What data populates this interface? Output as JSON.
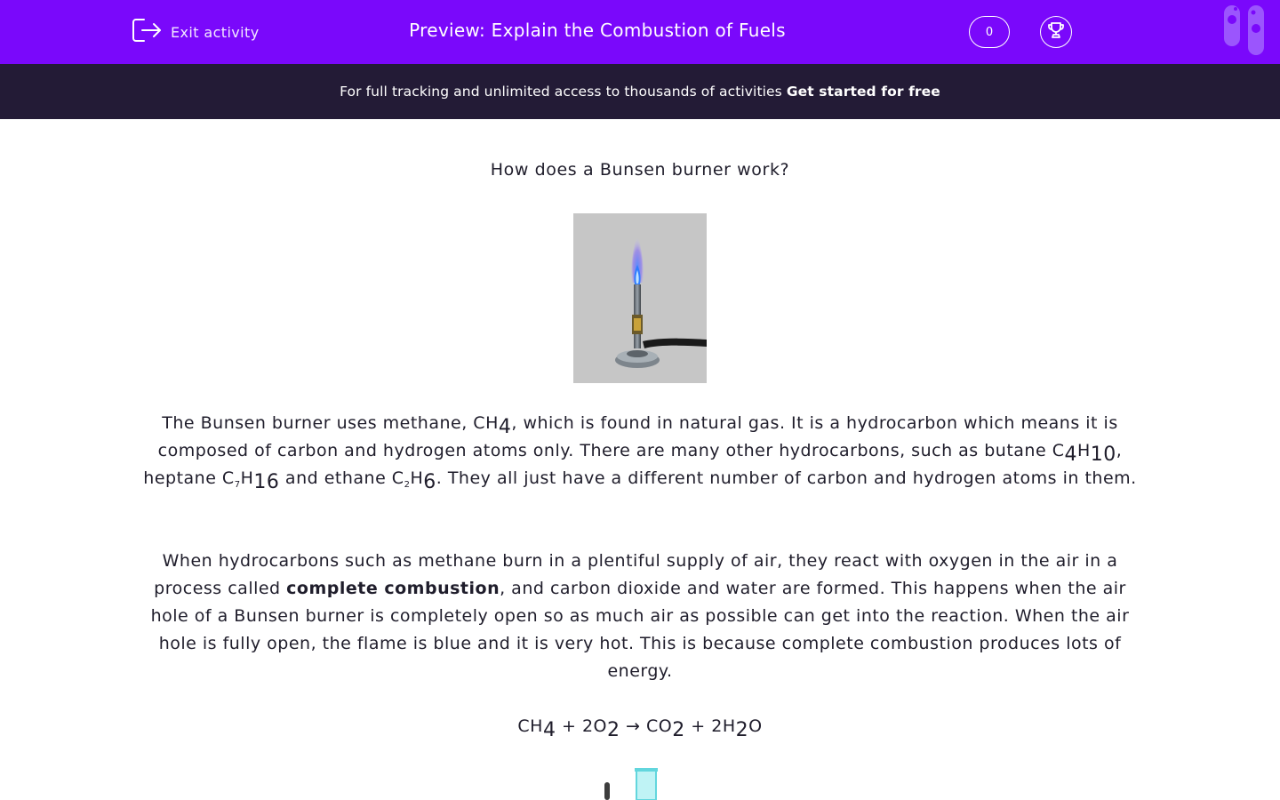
{
  "header": {
    "exit_label": "Exit activity",
    "title": "Preview: Explain the Combustion of Fuels",
    "score": "0",
    "accent_color": "#7a08fb"
  },
  "banner": {
    "text": "For full tracking and unlimited access to thousands of activities",
    "cta": "Get started for free",
    "background": "#231b36"
  },
  "content": {
    "question": "How does a Bunsen burner work?",
    "image_subject": "bunsen-burner-with-blue-flame",
    "p1": {
      "s1": "The Bunsen burner uses methane, CH",
      "n1": "4",
      "s2": ", which is found in natural gas. It is a hydrocarbon which means it is composed of carbon and hydrogen atoms only. There are many other hydrocarbons, such as butane C",
      "n2": "4",
      "s3": "H",
      "n3": "10",
      "s4": ", heptane C",
      "n4": "7",
      "s5": "H",
      "n5": "16",
      "s6": " and ethane C",
      "n6": "2",
      "s7": "H",
      "n7": "6",
      "s8": ". They all just have a different number of carbon and hydrogen atoms in them."
    },
    "p2": {
      "s1": "When hydrocarbons such as methane burn in a plentiful supply of air, they react with oxygen in the air in a process called ",
      "bold": "complete combustion",
      "s2": ", and carbon dioxide and water are formed. This happens when the air hole of a Bunsen burner is completely open so as much air as possible can get into the reaction. When the air hole is fully open, the flame is blue and it is very hot. This is because complete combustion produces lots of energy."
    },
    "equation": {
      "a": "CH",
      "a_n": "4",
      "b": " + 2O",
      "b_n": "2",
      "arrow": " → CO",
      "c_n": "2",
      "d": " + 2H",
      "d_n": "2",
      "e": "O"
    }
  }
}
